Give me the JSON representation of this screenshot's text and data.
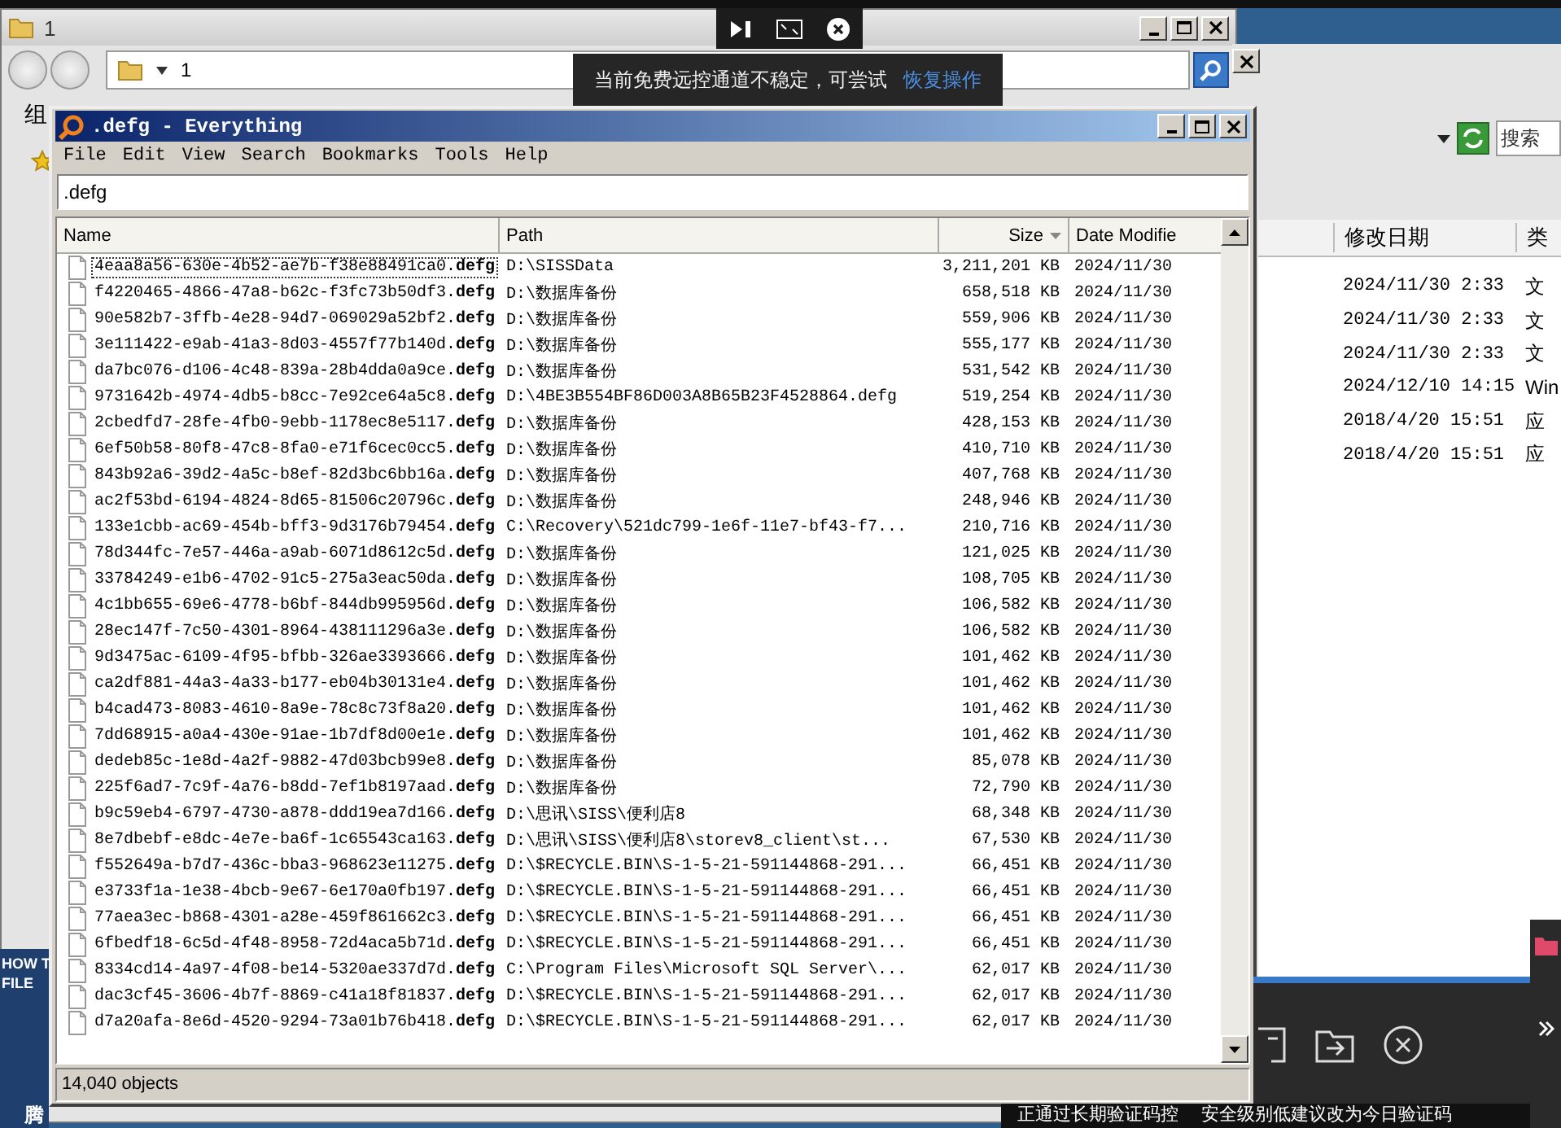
{
  "explorer_window": {
    "title": "1",
    "address": "1",
    "toolbar_label": "组"
  },
  "right_window": {
    "search_placeholder": "搜索",
    "columns": [
      "修改日期",
      "类"
    ],
    "rows": [
      {
        "date": "2024/11/30 2:33",
        "type": "文"
      },
      {
        "date": "2024/11/30 2:33",
        "type": "文"
      },
      {
        "date": "2024/11/30 2:33",
        "type": "文"
      },
      {
        "date": "2024/12/10 14:15",
        "type": "Win"
      },
      {
        "date": "2018/4/20 15:51",
        "type": "应"
      },
      {
        "date": "2018/4/20 15:51",
        "type": "应"
      }
    ]
  },
  "everything": {
    "title": ".defg - Everything",
    "menu": [
      "File",
      "Edit",
      "View",
      "Search",
      "Bookmarks",
      "Tools",
      "Help"
    ],
    "search": ".defg",
    "columns": [
      {
        "label": "Name",
        "sorted": false
      },
      {
        "label": "Path",
        "sorted": false
      },
      {
        "label": "Size",
        "sorted": true
      },
      {
        "label": "Date Modifie",
        "sorted": false
      }
    ],
    "rows": [
      {
        "name": "4eaa8a56-630e-4b52-ae7b-f38e88491ca0.**defg**",
        "path": "D:\\SISSData",
        "size": "3,211,201 KB",
        "date": "2024/11/30",
        "focused": true
      },
      {
        "name": "f4220465-4866-47a8-b62c-f3fc73b50df3.**defg**",
        "path": "D:\\数据库备份",
        "size": "658,518 KB",
        "date": "2024/11/30",
        "focused": false
      },
      {
        "name": "90e582b7-3ffb-4e28-94d7-069029a52bf2.**defg**",
        "path": "D:\\数据库备份",
        "size": "559,906 KB",
        "date": "2024/11/30",
        "focused": false
      },
      {
        "name": "3e111422-e9ab-41a3-8d03-4557f77b140d.**defg**",
        "path": "D:\\数据库备份",
        "size": "555,177 KB",
        "date": "2024/11/30",
        "focused": false
      },
      {
        "name": "da7bc076-d106-4c48-839a-28b4dda0a9ce.**defg**",
        "path": "D:\\数据库备份",
        "size": "531,542 KB",
        "date": "2024/11/30",
        "focused": false
      },
      {
        "name": "9731642b-4974-4db5-b8cc-7e92ce64a5c8.**defg**",
        "path": "D:\\4BE3B554BF86D003A8B65B23F4528864.defg",
        "size": "519,254 KB",
        "date": "2024/11/30",
        "focused": false
      },
      {
        "name": "2cbedfd7-28fe-4fb0-9ebb-1178ec8e5117.**defg**",
        "path": "D:\\数据库备份",
        "size": "428,153 KB",
        "date": "2024/11/30",
        "focused": false
      },
      {
        "name": "6ef50b58-80f8-47c8-8fa0-e71f6cec0cc5.**defg**",
        "path": "D:\\数据库备份",
        "size": "410,710 KB",
        "date": "2024/11/30",
        "focused": false
      },
      {
        "name": "843b92a6-39d2-4a5c-b8ef-82d3bc6bb16a.**defg**",
        "path": "D:\\数据库备份",
        "size": "407,768 KB",
        "date": "2024/11/30",
        "focused": false
      },
      {
        "name": "ac2f53bd-6194-4824-8d65-81506c20796c.**defg**",
        "path": "D:\\数据库备份",
        "size": "248,946 KB",
        "date": "2024/11/30",
        "focused": false
      },
      {
        "name": "133e1cbb-ac69-454b-bff3-9d3176b79454.**defg**",
        "path": "C:\\Recovery\\521dc799-1e6f-11e7-bf43-f7...",
        "size": "210,716 KB",
        "date": "2024/11/30",
        "focused": false
      },
      {
        "name": "78d344fc-7e57-446a-a9ab-6071d8612c5d.**defg**",
        "path": "D:\\数据库备份",
        "size": "121,025 KB",
        "date": "2024/11/30",
        "focused": false
      },
      {
        "name": "33784249-e1b6-4702-91c5-275a3eac50da.**defg**",
        "path": "D:\\数据库备份",
        "size": "108,705 KB",
        "date": "2024/11/30",
        "focused": false
      },
      {
        "name": "4c1bb655-69e6-4778-b6bf-844db995956d.**defg**",
        "path": "D:\\数据库备份",
        "size": "106,582 KB",
        "date": "2024/11/30",
        "focused": false
      },
      {
        "name": "28ec147f-7c50-4301-8964-438111296a3e.**defg**",
        "path": "D:\\数据库备份",
        "size": "106,582 KB",
        "date": "2024/11/30",
        "focused": false
      },
      {
        "name": "9d3475ac-6109-4f95-bfbb-326ae3393666.**defg**",
        "path": "D:\\数据库备份",
        "size": "101,462 KB",
        "date": "2024/11/30",
        "focused": false
      },
      {
        "name": "ca2df881-44a3-4a33-b177-eb04b30131e4.**defg**",
        "path": "D:\\数据库备份",
        "size": "101,462 KB",
        "date": "2024/11/30",
        "focused": false
      },
      {
        "name": "b4cad473-8083-4610-8a9e-78c8c73f8a20.**defg**",
        "path": "D:\\数据库备份",
        "size": "101,462 KB",
        "date": "2024/11/30",
        "focused": false
      },
      {
        "name": "7dd68915-a0a4-430e-91ae-1b7df8d00e1e.**defg**",
        "path": "D:\\数据库备份",
        "size": "101,462 KB",
        "date": "2024/11/30",
        "focused": false
      },
      {
        "name": "dedeb85c-1e8d-4a2f-9882-47d03bcb99e8.**defg**",
        "path": "D:\\数据库备份",
        "size": "85,078 KB",
        "date": "2024/11/30",
        "focused": false
      },
      {
        "name": "225f6ad7-7c9f-4a76-b8dd-7ef1b8197aad.**defg**",
        "path": "D:\\数据库备份",
        "size": "72,790 KB",
        "date": "2024/11/30",
        "focused": false
      },
      {
        "name": "b9c59eb4-6797-4730-a878-ddd19ea7d166.**defg**",
        "path": "D:\\思讯\\SISS\\便利店8",
        "size": "68,348 KB",
        "date": "2024/11/30",
        "focused": false
      },
      {
        "name": "8e7dbebf-e8dc-4e7e-ba6f-1c65543ca163.**defg**",
        "path": "D:\\思讯\\SISS\\便利店8\\storev8_client\\st...",
        "size": "67,530 KB",
        "date": "2024/11/30",
        "focused": false
      },
      {
        "name": "f552649a-b7d7-436c-bba3-968623e11275.**defg**",
        "path": "D:\\$RECYCLE.BIN\\S-1-5-21-591144868-291...",
        "size": "66,451 KB",
        "date": "2024/11/30",
        "focused": false
      },
      {
        "name": "e3733f1a-1e38-4bcb-9e67-6e170a0fb197.**defg**",
        "path": "D:\\$RECYCLE.BIN\\S-1-5-21-591144868-291...",
        "size": "66,451 KB",
        "date": "2024/11/30",
        "focused": false
      },
      {
        "name": "77aea3ec-b868-4301-a28e-459f861662c3.**defg**",
        "path": "D:\\$RECYCLE.BIN\\S-1-5-21-591144868-291...",
        "size": "66,451 KB",
        "date": "2024/11/30",
        "focused": false
      },
      {
        "name": "6fbedf18-6c5d-4f48-8958-72d4aca5b71d.**defg**",
        "path": "D:\\$RECYCLE.BIN\\S-1-5-21-591144868-291...",
        "size": "66,451 KB",
        "date": "2024/11/30",
        "focused": false
      },
      {
        "name": "8334cd14-4a97-4f08-be14-5320ae337d7d.**defg**",
        "path": "C:\\Program Files\\Microsoft SQL Server\\...",
        "size": "62,017 KB",
        "date": "2024/11/30",
        "focused": false
      },
      {
        "name": "dac3cf45-3606-4b7f-8869-c41a18f81837.**defg**",
        "path": "D:\\$RECYCLE.BIN\\S-1-5-21-591144868-291...",
        "size": "62,017 KB",
        "date": "2024/11/30",
        "focused": false
      },
      {
        "name": "d7a20afa-8e6d-4520-9294-73a01b76b418.**defg**",
        "path": "D:\\$RECYCLE.BIN\\S-1-5-21-591144868-291...",
        "size": "62,017 KB",
        "date": "2024/11/30",
        "focused": false
      }
    ],
    "status": "14,040 objects"
  },
  "remote_notice": {
    "message": "当前免费远控通道不稳定，可尝试",
    "action": "恢复操作"
  },
  "desktop_labels": [
    "HOW T",
    "FILE",
    "腾"
  ],
  "remote_bar": {
    "messages": [
      "正通过长期验证码控",
      "安全级别低建议改为今日验证码"
    ]
  }
}
